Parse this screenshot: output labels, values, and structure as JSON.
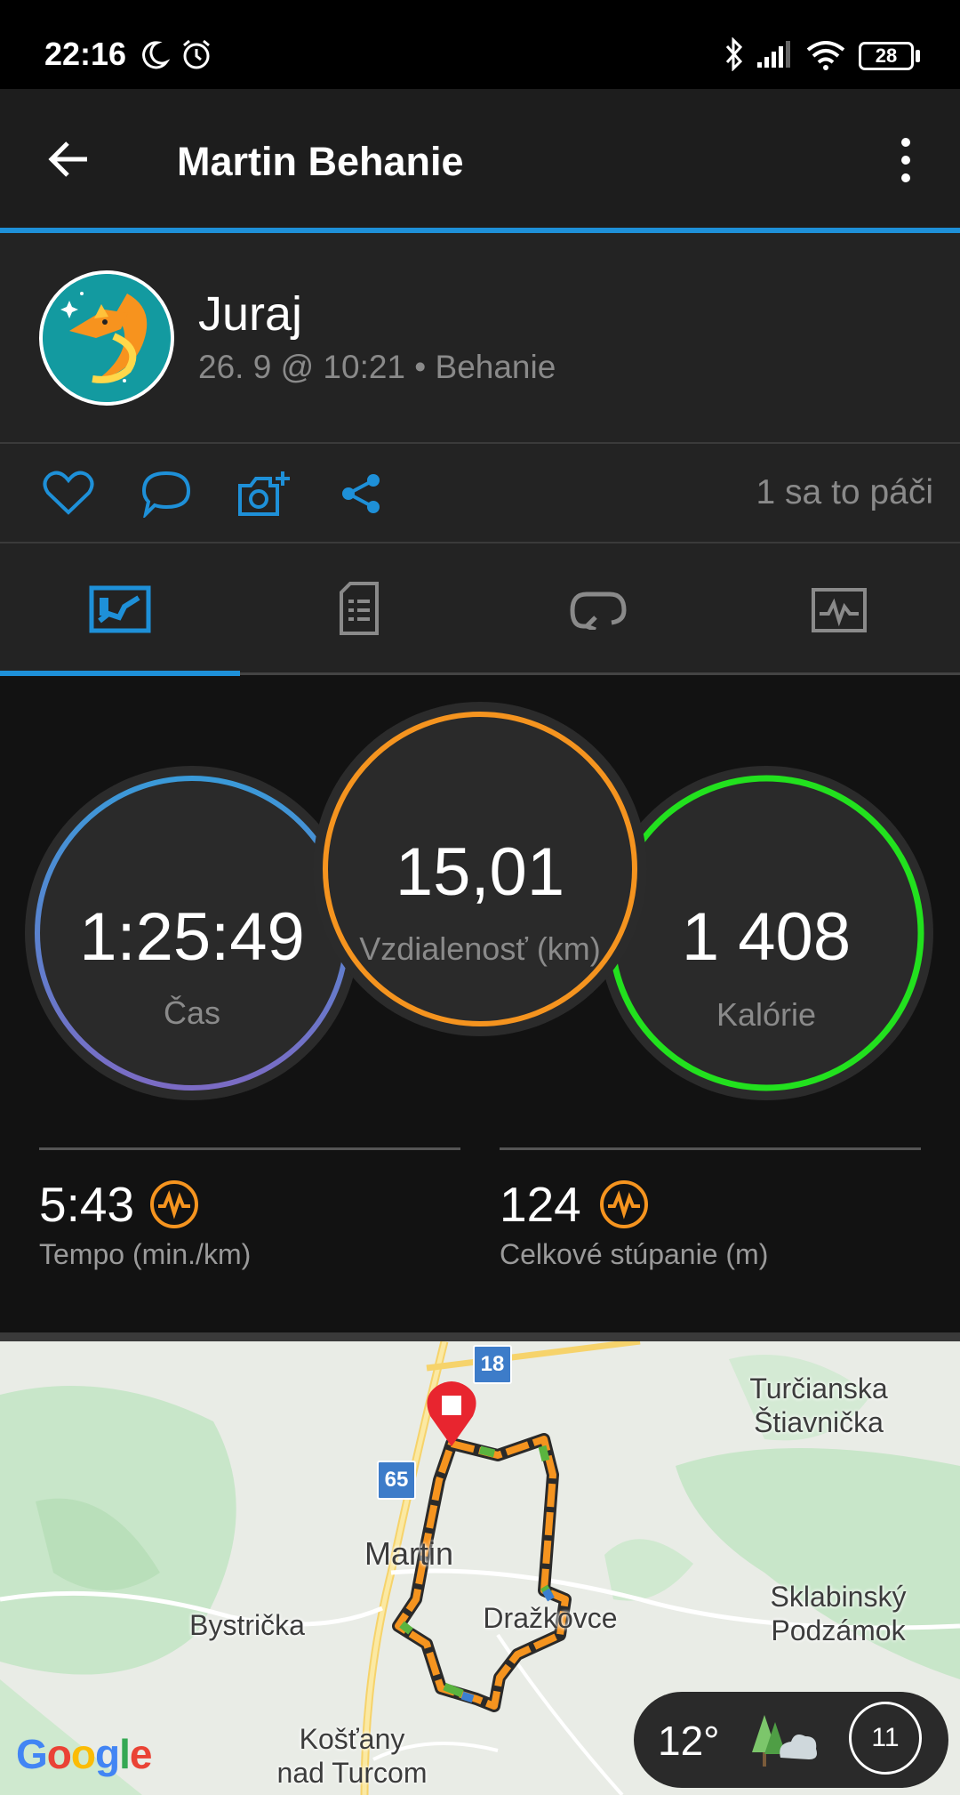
{
  "status_bar": {
    "time": "22:16",
    "battery": "28"
  },
  "app_bar": {
    "title": "Martin Behanie"
  },
  "profile": {
    "name": "Juraj",
    "meta": "26. 9 @ 10:21 • Behanie"
  },
  "actions": {
    "likes": "1 sa to páči"
  },
  "tabs": [
    {
      "name": "summary",
      "icon": "run-stats-icon",
      "active": true
    },
    {
      "name": "details",
      "icon": "document-icon",
      "active": false
    },
    {
      "name": "laps",
      "icon": "loop-icon",
      "active": false
    },
    {
      "name": "charts",
      "icon": "chart-icon",
      "active": false
    }
  ],
  "stats": {
    "time": {
      "value": "1:25:49",
      "label": "Čas"
    },
    "distance": {
      "value": "15,01",
      "label": "Vzdialenosť (km)"
    },
    "calories": {
      "value": "1 408",
      "label": "Kalórie"
    },
    "pace": {
      "value": "5:43",
      "label": "Tempo (min./km)"
    },
    "ascent": {
      "value": "124",
      "label": "Celkové stúpanie (m)"
    }
  },
  "colors": {
    "accent": "#1e90d8",
    "time_ring_start": "#3a9ad9",
    "time_ring_end": "#7b6bc4",
    "distance_ring": "#f5941f",
    "calories_ring": "#22e11e",
    "metric_icon": "#f5941f"
  },
  "map": {
    "places": {
      "turcianska": "Turčianska\nŠtiavnička",
      "martin": "Martin",
      "bystricka": "Bystrička",
      "drazkovce": "Dražkovce",
      "sklabinsky": "Sklabinský\nPodzámok",
      "kostany": "Košťany\nnad Turcom"
    },
    "roads": {
      "r18": "18",
      "r65": "65"
    },
    "weather": {
      "temp": "12°",
      "aqi": "11"
    },
    "attribution": "Google"
  }
}
